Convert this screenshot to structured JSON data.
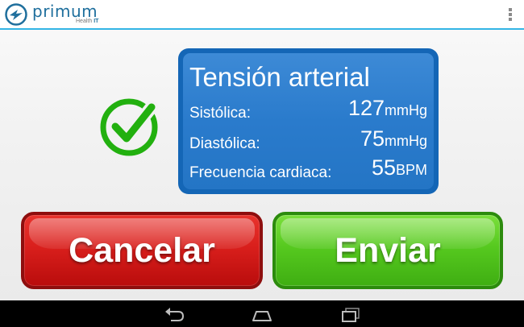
{
  "app": {
    "brand_name": "primum",
    "brand_sub": "Health",
    "brand_sub_suffix": "IT",
    "accent_color": "#33b5e5",
    "overflow_icon": "overflow-menu-icon"
  },
  "status_icon": "checkmark-circle-icon",
  "reading": {
    "title": "Tensión arterial",
    "rows": [
      {
        "label": "Sistólica:",
        "value": "127",
        "unit": "mmHg"
      },
      {
        "label": "Diastólica:",
        "value": "75",
        "unit": "mmHg"
      },
      {
        "label": "Frecuencia cardiaca:",
        "value": "55",
        "unit": "BPM"
      }
    ]
  },
  "actions": {
    "cancel_label": "Cancelar",
    "cancel_color": "#d91f1c",
    "send_label": "Enviar",
    "send_color": "#56c91f"
  },
  "nav": {
    "back_icon": "back-icon",
    "home_icon": "home-icon",
    "recents_icon": "recent-apps-icon"
  }
}
